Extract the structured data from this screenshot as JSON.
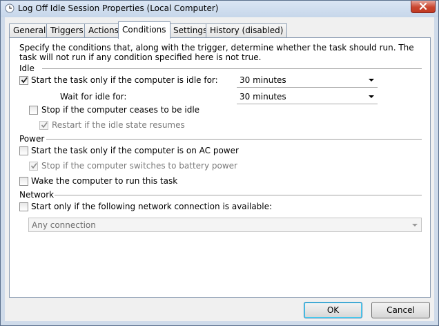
{
  "window": {
    "title": "Log Off Idle Session Properties (Local Computer)"
  },
  "tabs": [
    {
      "label": "General"
    },
    {
      "label": "Triggers"
    },
    {
      "label": "Actions"
    },
    {
      "label": "Conditions",
      "active": true
    },
    {
      "label": "Settings"
    },
    {
      "label": "History (disabled)"
    }
  ],
  "conditions": {
    "description": "Specify the conditions that, along with the trigger, determine whether the task should run.  The task will not run  if any condition specified here is not true.",
    "idle": {
      "heading": "Idle",
      "start_if_idle": {
        "label": "Start the task only if the computer is idle for:",
        "checked": true,
        "value": "30 minutes"
      },
      "wait_for_idle": {
        "label": "Wait for idle for:",
        "value": "30 minutes"
      },
      "stop_if_not_idle": {
        "label": "Stop if the computer ceases to be idle",
        "checked": false
      },
      "restart_if_idle_resumes": {
        "label": "Restart if the idle state resumes",
        "checked": true,
        "disabled": true
      }
    },
    "power": {
      "heading": "Power",
      "ac_power_only": {
        "label": "Start the task only if the computer is on AC power",
        "checked": false
      },
      "stop_on_battery": {
        "label": "Stop if the computer switches to battery power",
        "checked": true,
        "disabled": true
      },
      "wake_to_run": {
        "label": "Wake the computer to run this task",
        "checked": false
      }
    },
    "network": {
      "heading": "Network",
      "require_connection": {
        "label": "Start only if the following network connection is available:",
        "checked": false
      },
      "connection": {
        "value": "Any connection",
        "disabled": true
      }
    }
  },
  "buttons": {
    "ok": "OK",
    "cancel": "Cancel"
  },
  "colors": {
    "accent": "#3c7fb1",
    "close_button": "#c9462f",
    "frame": "#cfdbea"
  },
  "icons": {
    "title": "clock-icon",
    "close": "close-icon",
    "check": "checkmark-icon",
    "dropdown": "chevron-down-icon"
  }
}
